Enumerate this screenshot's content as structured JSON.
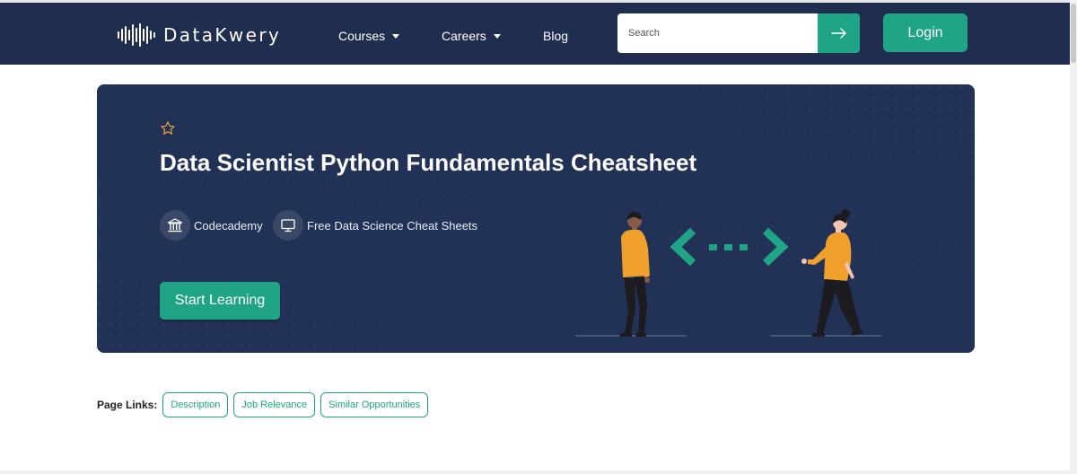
{
  "brand": {
    "name": "DataKwery"
  },
  "nav": {
    "items": [
      {
        "label": "Courses",
        "dropdown": true
      },
      {
        "label": "Careers",
        "dropdown": true
      },
      {
        "label": "Blog",
        "dropdown": false
      }
    ]
  },
  "search": {
    "placeholder": "Search",
    "value": "",
    "button_icon": "arrow-right-icon"
  },
  "login": {
    "label": "Login"
  },
  "hero": {
    "favorite_icon": "star-outline-icon",
    "title": "Data Scientist Python Fundamentals Cheatsheet",
    "meta": [
      {
        "icon": "institution-icon",
        "label": "Codecademy"
      },
      {
        "icon": "monitor-icon",
        "label": "Free Data Science Cheat Sheets"
      }
    ],
    "cta": "Start Learning",
    "illustration": "two-people-exchange-illustration"
  },
  "page_links": {
    "label": "Page Links:",
    "items": [
      "Description",
      "Job Relevance",
      "Similar Opportunities"
    ]
  },
  "colors": {
    "navy": "#1f2d4f",
    "hero": "#223257",
    "accent": "#20a486",
    "star": "#e8a735",
    "figure_shirt": "#f0a02c"
  }
}
